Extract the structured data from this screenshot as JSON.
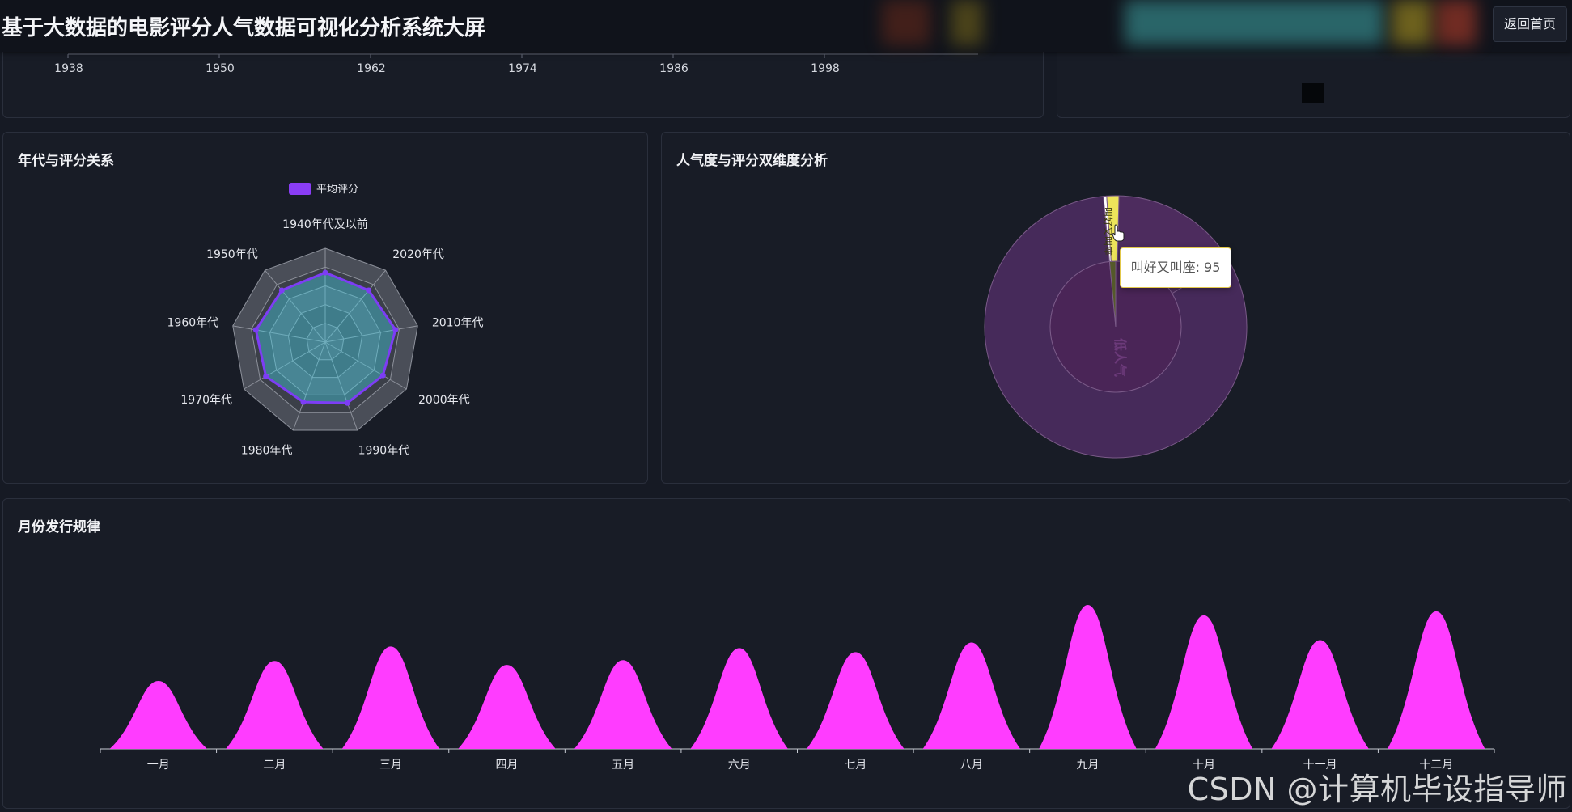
{
  "header": {
    "title": "基于大数据的电影评分人气数据可视化分析系统大屏",
    "back_button": "返回首页"
  },
  "top_left_panel": {
    "axis_ticks": [
      "1938",
      "1950",
      "1962",
      "1974",
      "1986",
      "1998"
    ]
  },
  "radar_panel": {
    "title": "年代与评分关系",
    "legend": "平均评分",
    "color": "#8a3df5",
    "chart_data": {
      "type": "radar",
      "title": "年代与评分关系",
      "legend": [
        "平均评分"
      ],
      "indicators": [
        "1940年代及以前",
        "2020年代",
        "2010年代",
        "2000年代",
        "1990年代",
        "1980年代",
        "1970年代",
        "1960年代",
        "1950年代"
      ],
      "values": [
        0.74,
        0.72,
        0.76,
        0.71,
        0.69,
        0.68,
        0.73,
        0.75,
        0.72
      ]
    }
  },
  "sunburst_panel": {
    "title": "人气度与评分双维度分析",
    "inner_label": "低人气",
    "outer_segment_label": "叫好又叫座",
    "tooltip": "叫好又叫座: 95",
    "chart_data": {
      "type": "sunburst",
      "title": "人气度与评分双维度分析",
      "inner": [
        {
          "name": "低人气",
          "share": 0.985
        },
        {
          "name": "",
          "share": 0.015
        }
      ],
      "outer": [
        {
          "name": "",
          "share": 0.165
        },
        {
          "name": "",
          "share": 0.82
        },
        {
          "name": "",
          "share": 0.004
        },
        {
          "name": "叫好又叫座",
          "share": 0.015,
          "value": 95
        }
      ]
    }
  },
  "monthly_panel": {
    "title": "月份发行规律",
    "color": "#ff3cff",
    "chart_data": {
      "type": "area",
      "title": "月份发行规律",
      "categories": [
        "一月",
        "二月",
        "三月",
        "四月",
        "五月",
        "六月",
        "七月",
        "八月",
        "九月",
        "十月",
        "十一月",
        "十二月"
      ],
      "values": [
        85,
        110,
        128,
        105,
        111,
        126,
        121,
        133,
        180,
        167,
        136,
        172
      ]
    }
  },
  "watermark": "CSDN @计算机毕设指导师"
}
